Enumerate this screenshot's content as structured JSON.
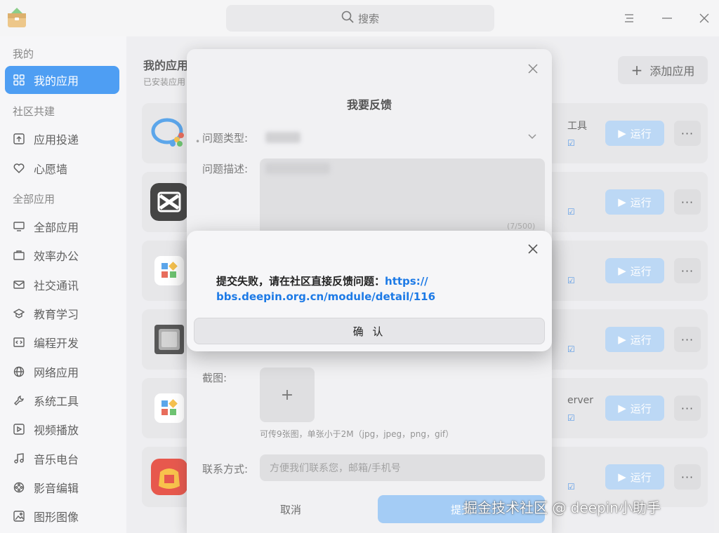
{
  "search": {
    "label": "搜索"
  },
  "sidebar": {
    "sections": [
      {
        "title": "我的",
        "items": [
          {
            "label": "我的应用",
            "icon": "grid-icon",
            "active": true
          }
        ]
      },
      {
        "title": "社区共建",
        "items": [
          {
            "label": "应用投递",
            "icon": "upload-icon"
          },
          {
            "label": "心愿墙",
            "icon": "heart-icon"
          }
        ]
      },
      {
        "title": "全部应用",
        "items": [
          {
            "label": "全部应用",
            "icon": "monitor-icon"
          },
          {
            "label": "效率办公",
            "icon": "briefcase-icon"
          },
          {
            "label": "社交通讯",
            "icon": "mail-icon"
          },
          {
            "label": "教育学习",
            "icon": "graduation-cap-icon"
          },
          {
            "label": "编程开发",
            "icon": "code-icon"
          },
          {
            "label": "网络应用",
            "icon": "globe-icon"
          },
          {
            "label": "系统工具",
            "icon": "wrench-icon"
          },
          {
            "label": "视频播放",
            "icon": "play-icon"
          },
          {
            "label": "音乐电台",
            "icon": "music-icon"
          },
          {
            "label": "影音编辑",
            "icon": "film-reel-icon"
          },
          {
            "label": "图形图像",
            "icon": "image-icon"
          }
        ]
      }
    ]
  },
  "main": {
    "title": "我的应用",
    "subtitle": "已安装应用",
    "add_button": "添加应用",
    "run_label": "运行",
    "more_label": "···",
    "cards": [
      {
        "icon": "wecom-app-icon",
        "text": "工具",
        "edit": "☑"
      },
      {
        "icon": "capcut-app-icon",
        "text": "",
        "edit": "☑"
      },
      {
        "icon": "deepin-app-icon",
        "text": "",
        "edit": "☑"
      },
      {
        "icon": "chip-app-icon",
        "text": "",
        "edit": "☑"
      },
      {
        "icon": "deepin-app-icon",
        "text": "erver",
        "edit": "☑"
      },
      {
        "icon": "mail-app-icon",
        "text": "",
        "edit": "☑"
      }
    ]
  },
  "feedback": {
    "title": "我要反馈",
    "type_label": "问题类型:",
    "desc_label": "问题描述:",
    "counter": "(7/500)",
    "screenshot_label": "截图:",
    "screenshot_add": "+",
    "screenshot_hint": "可传9张图，单张小于2M（jpg，jpeg，png，gif）",
    "contact_label": "联系方式:",
    "contact_placeholder": "方便我们联系您，邮箱/手机号",
    "cancel": "取消",
    "submit": "提交"
  },
  "error_dialog": {
    "message": "提交失败，请在社区直接反馈问题：",
    "link_part1": "https://",
    "link_part2": "bbs.deepin.org.cn/module/detail/116",
    "confirm": "确 认"
  },
  "watermark": "掘金技术社区 @ deepin小助手",
  "colors": {
    "accent": "#1d83f0",
    "link": "#1d7ae6",
    "run_button": "#aacdf2"
  }
}
